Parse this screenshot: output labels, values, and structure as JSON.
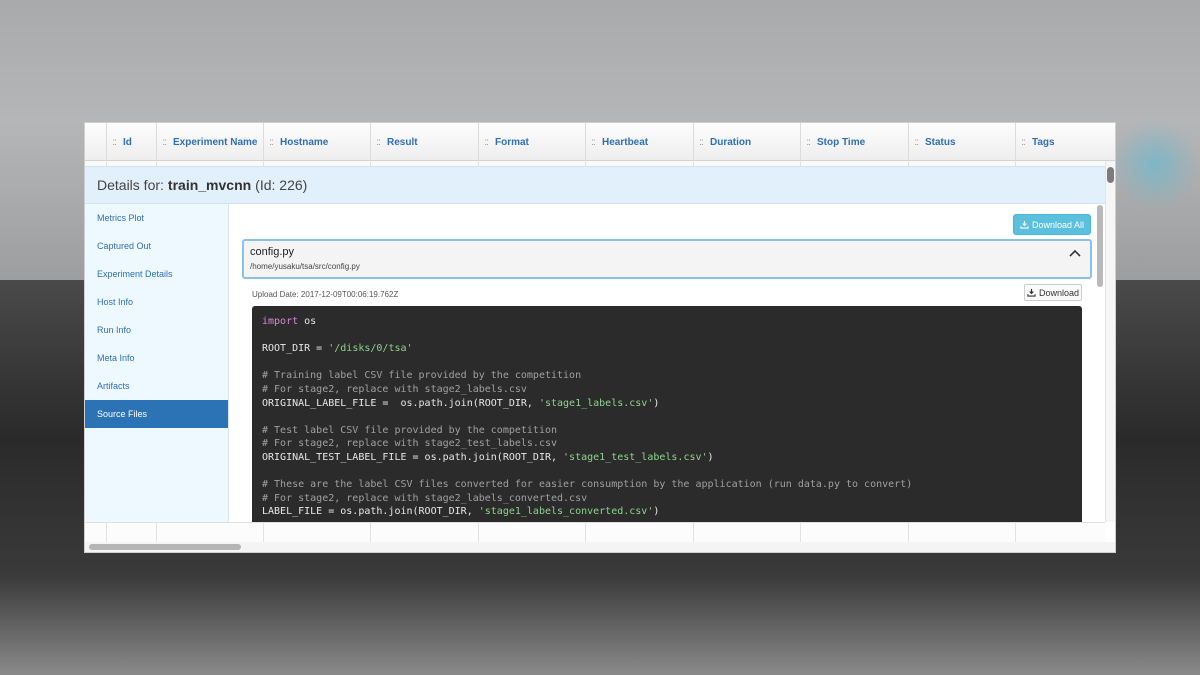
{
  "table": {
    "columns": [
      "Id",
      "Experiment Name",
      "Hostname",
      "Result",
      "Format",
      "Heartbeat",
      "Duration",
      "Stop Time",
      "Status",
      "Tags"
    ],
    "grip_icon": "::"
  },
  "details": {
    "prefix": "Details for:",
    "name": "train_mvcnn",
    "id_text": "(Id: 226)"
  },
  "sidebar": {
    "items": [
      {
        "label": "Metrics Plot",
        "active": false
      },
      {
        "label": "Captured Out",
        "active": false
      },
      {
        "label": "Experiment Details",
        "active": false
      },
      {
        "label": "Host Info",
        "active": false
      },
      {
        "label": "Run Info",
        "active": false
      },
      {
        "label": "Meta Info",
        "active": false
      },
      {
        "label": "Artifacts",
        "active": false
      },
      {
        "label": "Source Files",
        "active": true
      }
    ]
  },
  "source": {
    "download_all_label": "Download All",
    "download_label": "Download",
    "file_name": "config.py",
    "file_path": "/home/yusaku/tsa/src/config.py",
    "upload_date": "Upload Date: 2017-12-09T00:06:19.762Z",
    "icons": {
      "download": "download-icon",
      "collapse": "chevron-up-icon"
    }
  },
  "code": {
    "lines": [
      [
        {
          "t": "import",
          "c": "kw"
        },
        {
          "t": " os",
          "c": ""
        }
      ],
      [],
      [
        {
          "t": "ROOT_DIR = ",
          "c": ""
        },
        {
          "t": "'/disks/0/tsa'",
          "c": "str"
        }
      ],
      [],
      [
        {
          "t": "# Training label CSV file provided by the competition",
          "c": "cm"
        }
      ],
      [
        {
          "t": "# For stage2, replace with stage2_labels.csv",
          "c": "cm"
        }
      ],
      [
        {
          "t": "ORIGINAL_LABEL_FILE =  os.path.join(ROOT_DIR, ",
          "c": ""
        },
        {
          "t": "'stage1_labels.csv'",
          "c": "str"
        },
        {
          "t": ")",
          "c": ""
        }
      ],
      [],
      [
        {
          "t": "# Test label CSV file provided by the competition",
          "c": "cm"
        }
      ],
      [
        {
          "t": "# For stage2, replace with stage2_test_labels.csv",
          "c": "cm"
        }
      ],
      [
        {
          "t": "ORIGINAL_TEST_LABEL_FILE = os.path.join(ROOT_DIR, ",
          "c": ""
        },
        {
          "t": "'stage1_test_labels.csv'",
          "c": "str"
        },
        {
          "t": ")",
          "c": ""
        }
      ],
      [],
      [
        {
          "t": "# These are the label CSV files converted for easier consumption by the application (run data.py to convert)",
          "c": "cm"
        }
      ],
      [
        {
          "t": "# For stage2, replace with stage2_labels_converted.csv",
          "c": "cm"
        }
      ],
      [
        {
          "t": "LABEL_FILE = os.path.join(ROOT_DIR, ",
          "c": ""
        },
        {
          "t": "'stage1_labels_converted.csv'",
          "c": "str"
        },
        {
          "t": ")",
          "c": ""
        }
      ]
    ]
  }
}
